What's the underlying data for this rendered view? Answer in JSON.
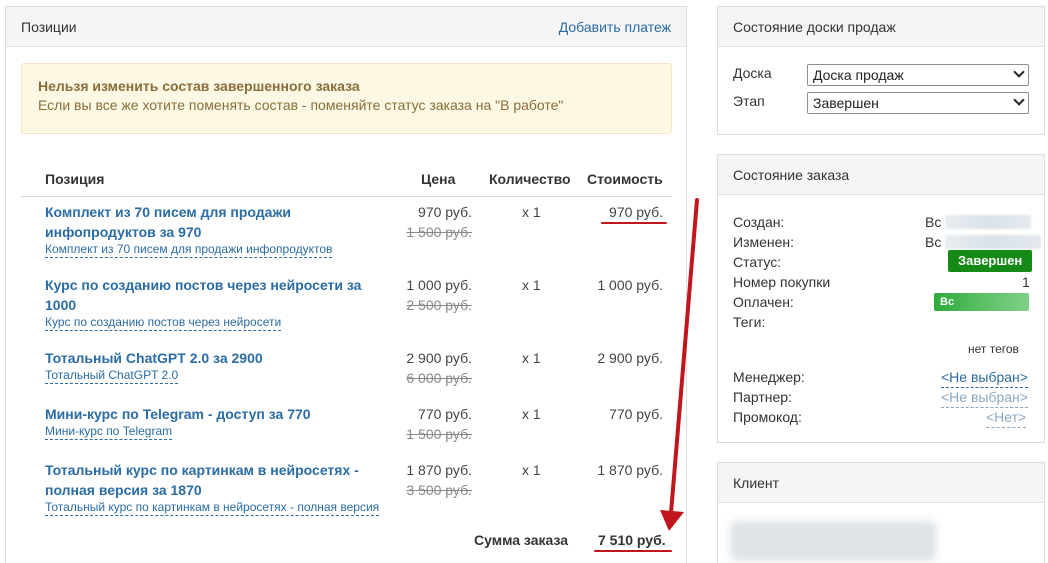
{
  "left": {
    "title": "Позиции",
    "add_payment": "Добавить платеж",
    "alert": {
      "title": "Нельзя изменить состав завершенного заказа",
      "text": "Если вы все же хотите поменять состав - поменяйте статус заказа на \"В работе\""
    },
    "table": {
      "headers": {
        "name": "Позиция",
        "price": "Цена",
        "qty": "Количество",
        "cost": "Стоимость"
      },
      "rows": [
        {
          "name": "Комплект из 70 писем для продажи инфопродуктов за 970",
          "sub": "Комплект из 70 писем для продажи инфопродуктов",
          "price": "970 руб.",
          "old": "1 500 руб.",
          "qty": "x 1",
          "cost": "970 руб."
        },
        {
          "name": "Курс по созданию постов через нейросети за 1000",
          "sub": "Курс по созданию постов через нейросети",
          "price": "1 000 руб.",
          "old": "2 500 руб.",
          "qty": "x 1",
          "cost": "1 000 руб."
        },
        {
          "name": "Тотальный ChatGPT 2.0 за 2900",
          "sub": "Тотальный ChatGPT 2.0",
          "price": "2 900 руб.",
          "old": "6 000 руб.",
          "qty": "x 1",
          "cost": "2 900 руб."
        },
        {
          "name": "Мини-курс по Telegram - доступ за 770",
          "sub": "Мини-курс по Telegram",
          "price": "770 руб.",
          "old": "1 500 руб.",
          "qty": "x 1",
          "cost": "770 руб."
        },
        {
          "name": "Тотальный курс по картинкам в нейросетях - полная версия за 1870",
          "sub": "Тотальный курс по картинкам в нейросетях - полная версия",
          "price": "1 870 руб.",
          "old": "3 500 руб.",
          "qty": "x 1",
          "cost": "1 870 руб."
        }
      ]
    },
    "total": {
      "label": "Сумма заказа",
      "value": "7 510 руб."
    }
  },
  "board": {
    "title": "Состояние доски продаж",
    "board_label": "Доска",
    "board_value": "Доска продаж",
    "stage_label": "Этап",
    "stage_value": "Завершен"
  },
  "order": {
    "title": "Состояние заказа",
    "created_label": "Создан:",
    "created_value": "Вс",
    "changed_label": "Изменен:",
    "changed_value": "Вс",
    "status_label": "Статус:",
    "status_value": "Завершен",
    "purchase_label": "Номер покупки",
    "purchase_value": "1",
    "paid_label": "Оплачен:",
    "paid_value": "Вс",
    "tags_label": "Теги:",
    "no_tags": "нет тегов",
    "manager_label": "Менеджер:",
    "manager_value": "<Не выбран>",
    "partner_label": "Партнер:",
    "partner_value": "<Не выбран>",
    "promo_label": "Промокод:",
    "promo_value": "<Нет>"
  },
  "client": {
    "title": "Клиент"
  },
  "colors": {
    "link": "#2a6ca3",
    "status_green": "#158a17",
    "annotation_red": "#c0161c",
    "alert_bg": "#fcf8e3"
  }
}
